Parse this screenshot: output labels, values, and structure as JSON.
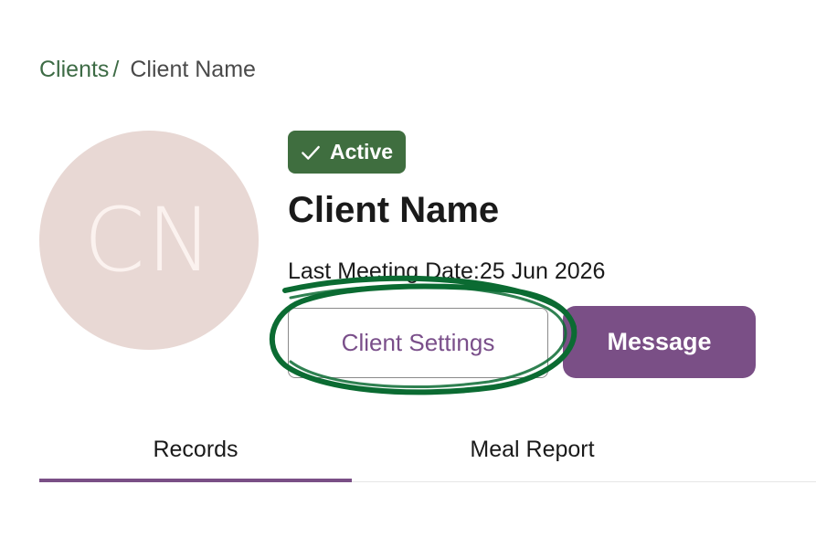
{
  "breadcrumb": {
    "parent": "Clients",
    "separator": "/",
    "current": "Client Name"
  },
  "avatar": {
    "initials": "CN",
    "background": "#e8d8d4"
  },
  "status": {
    "label": "Active",
    "icon": "check-icon",
    "color": "#3f6e3f"
  },
  "client": {
    "name": "Client Name",
    "last_meeting_label": "Last Meeting Date:",
    "last_meeting_value": "25 Jun 2026"
  },
  "actions": {
    "settings_label": "Client Settings",
    "message_label": "Message",
    "accent": "#7a4f86"
  },
  "tabs": [
    {
      "label": "Records",
      "active": true
    },
    {
      "label": "Meal Report",
      "active": false
    }
  ],
  "annotation": {
    "color": "#0b6b32",
    "target": "Client Settings"
  }
}
